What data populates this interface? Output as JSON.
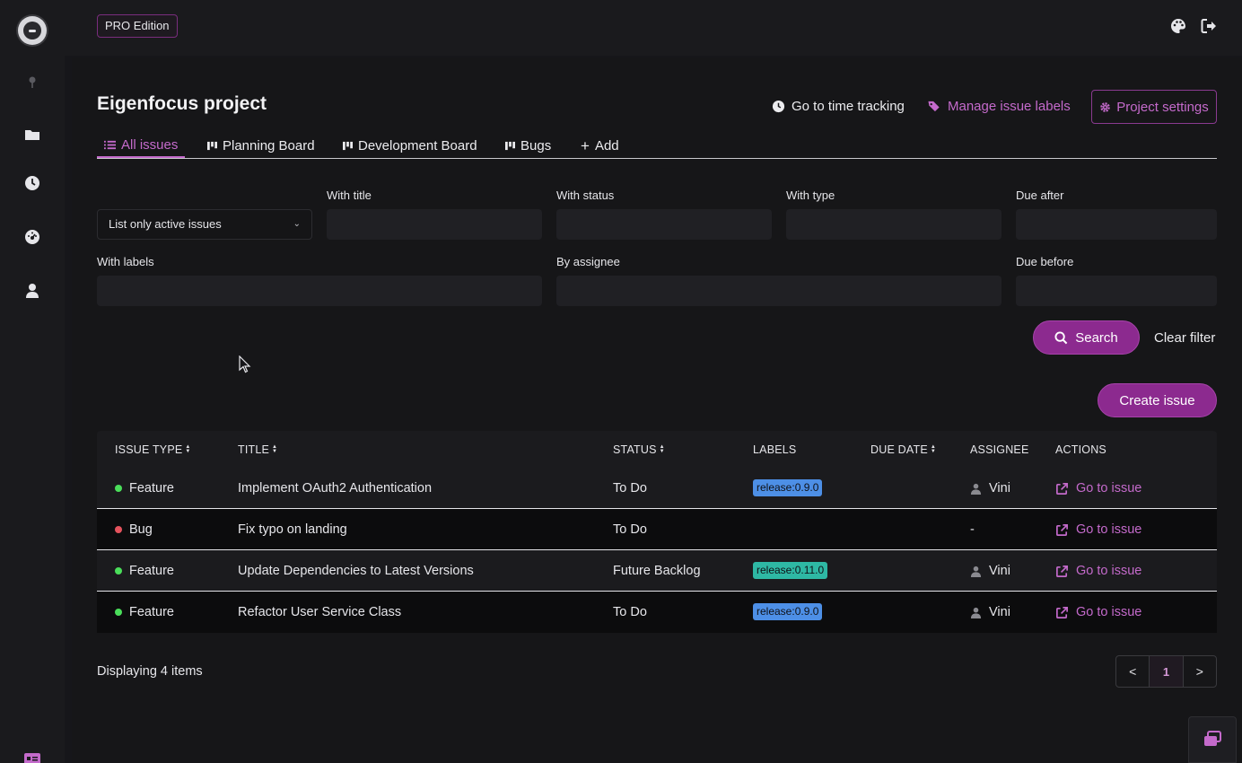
{
  "topbar": {
    "edition_badge": "PRO Edition"
  },
  "project": {
    "title": "Eigenfocus project",
    "links": {
      "time_tracking": "Go to time tracking",
      "manage_labels": "Manage issue labels",
      "settings": "Project settings"
    }
  },
  "tabs": [
    {
      "label": "All issues",
      "icon": "list-icon",
      "active": true
    },
    {
      "label": "Planning Board",
      "icon": "board-icon"
    },
    {
      "label": "Development Board",
      "icon": "board-icon"
    },
    {
      "label": "Bugs",
      "icon": "board-icon"
    },
    {
      "label": "Add",
      "icon": "plus-icon"
    }
  ],
  "filters": {
    "active_select": "List only active issues",
    "with_title": "With title",
    "with_status": "With status",
    "with_type": "With type",
    "due_after": "Due after",
    "with_labels": "With labels",
    "by_assignee": "By assignee",
    "due_before": "Due before",
    "search_button": "Search",
    "clear_button": "Clear filter"
  },
  "create_button": "Create issue",
  "table": {
    "headers": {
      "issue_type": "ISSUE TYPE",
      "title": "TITLE",
      "status": "STATUS",
      "labels": "LABELS",
      "due_date": "DUE DATE",
      "assignee": "ASSIGNEE",
      "actions": "ACTIONS"
    },
    "rows": [
      {
        "type": "Feature",
        "type_color": "#4ade5a",
        "title": "Implement OAuth2 Authentication",
        "status": "To Do",
        "label": "release:0.9.0",
        "label_color": "#4d8fe6",
        "due": "",
        "assignee": "Vini",
        "action": "Go to issue"
      },
      {
        "type": "Bug",
        "type_color": "#e5535d",
        "title": "Fix typo on landing",
        "status": "To Do",
        "label": "",
        "label_color": "",
        "due": "",
        "assignee": "-",
        "action": "Go to issue"
      },
      {
        "type": "Feature",
        "type_color": "#4ade5a",
        "title": "Update Dependencies to Latest Versions",
        "status": "Future Backlog",
        "label": "release:0.11.0",
        "label_color": "#2eb8a4",
        "due": "",
        "assignee": "Vini",
        "action": "Go to issue"
      },
      {
        "type": "Feature",
        "type_color": "#4ade5a",
        "title": "Refactor User Service Class",
        "status": "To Do",
        "label": "release:0.9.0",
        "label_color": "#4d8fe6",
        "due": "",
        "assignee": "Vini",
        "action": "Go to issue"
      }
    ]
  },
  "footer": {
    "count_text": "Displaying 4 items"
  },
  "pagination": {
    "prev": "<",
    "current": "1",
    "next": ">"
  },
  "colors": {
    "accent": "#c46acb",
    "button": "#8c2a8f"
  }
}
